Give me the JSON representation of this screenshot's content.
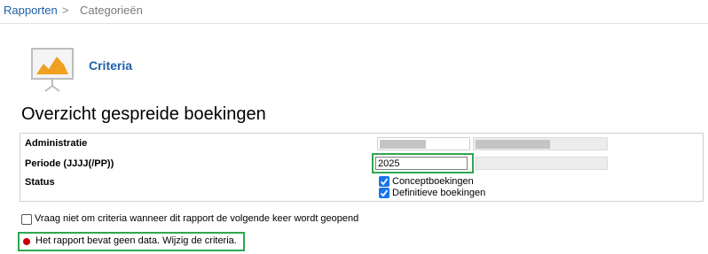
{
  "breadcrumb": {
    "link": "Rapporten",
    "separator": ">",
    "current": "Categorieën"
  },
  "header": {
    "section_title": "Criteria",
    "page_title": "Overzicht gespreide boekingen",
    "icon": "presentation-chart-icon"
  },
  "criteria": {
    "administratie_label": "Administratie",
    "periode_label": "Periode (JJJJ(/PP))",
    "periode_value": "2025",
    "status_label": "Status",
    "status_options": [
      {
        "label": "Conceptboekingen",
        "checked": true
      },
      {
        "label": "Definitieve boekingen",
        "checked": true
      }
    ]
  },
  "ask_again": {
    "label": "Vraag niet om criteria wanneer dit rapport de volgende keer wordt geopend",
    "checked": false
  },
  "message": {
    "text": "Het rapport bevat geen data. Wijzig de criteria.",
    "status_color": "#c80000"
  },
  "colors": {
    "accent": "#1f5fa8",
    "highlight": "#2fa84f",
    "checkbox": "#1a73e8",
    "chart_orange": "#f0a020"
  }
}
